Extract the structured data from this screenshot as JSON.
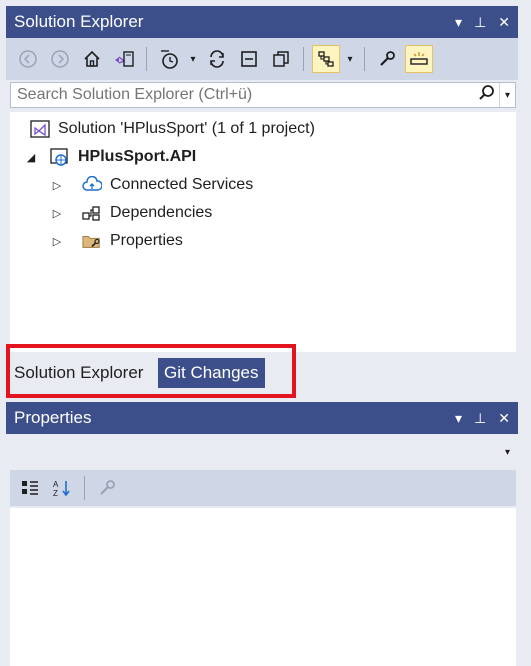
{
  "solution_explorer": {
    "title": "Solution Explorer",
    "title_icons": [
      "▾",
      "⊥",
      "✕"
    ],
    "toolbar": {
      "back": "◀",
      "forward": "▶",
      "home": "⌂",
      "switch_views": "▯",
      "pending_filter": "◷",
      "dropdown": "▾",
      "sync": "⟳",
      "collapse_all": "▭",
      "copy": "⧉",
      "show_all": "⊞",
      "properties": "🔧",
      "preview": "▭"
    },
    "search": {
      "placeholder": "Search Solution Explorer (Ctrl+ü)"
    },
    "tree": {
      "solution": "Solution 'HPlusSport' (1 of 1 project)",
      "project": "HPlusSport.API",
      "items": [
        {
          "label": "Connected Services"
        },
        {
          "label": "Dependencies"
        },
        {
          "label": "Properties"
        }
      ]
    }
  },
  "tabs": [
    {
      "label": "Solution Explorer"
    },
    {
      "label": "Git Changes"
    }
  ],
  "properties_panel": {
    "title": "Properties",
    "title_icons": [
      "▾",
      "⊥",
      "✕"
    ],
    "select_arrow": "▾"
  },
  "colors": {
    "title_bar": "#3c4f8a",
    "toolbar": "#cfd6e6",
    "background": "#e8ebf2",
    "highlight": "#e3141e"
  }
}
